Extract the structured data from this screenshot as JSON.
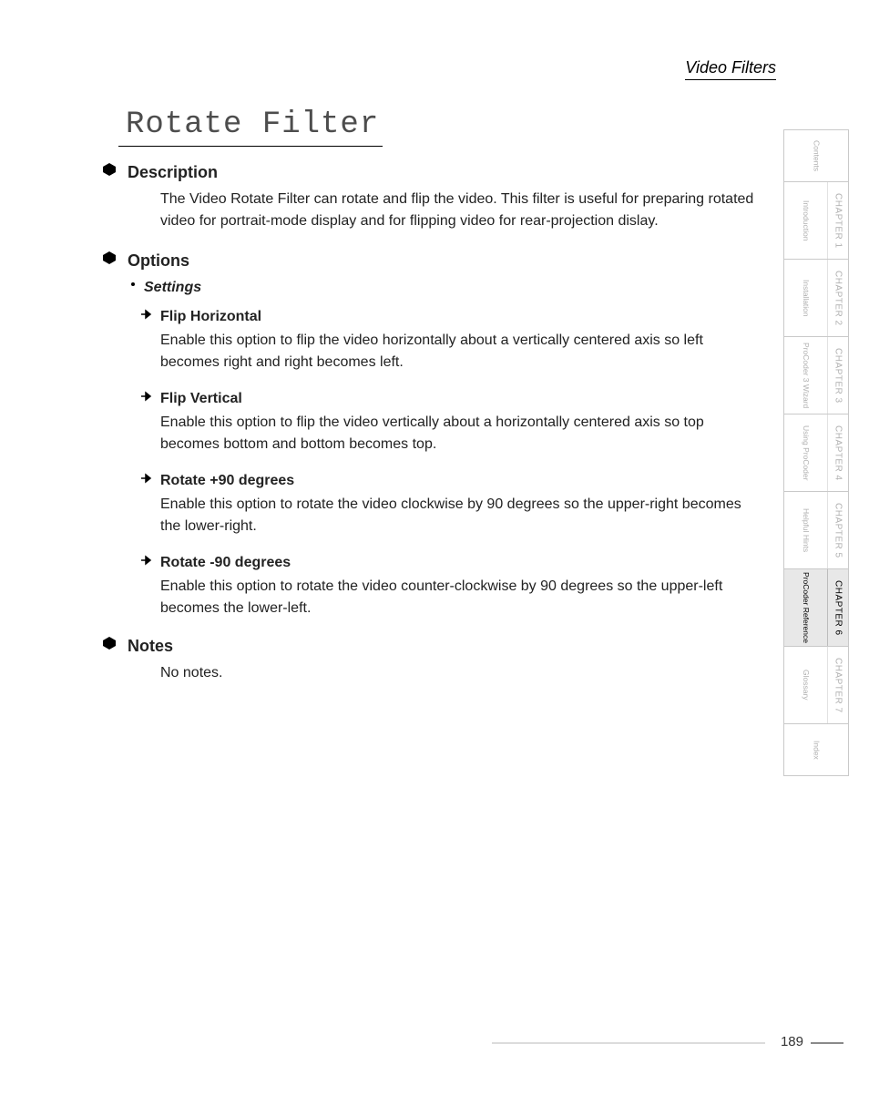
{
  "breadcrumb": "Video Filters",
  "title": "Rotate Filter",
  "sections": {
    "description": {
      "heading": "Description",
      "body": "The Video Rotate Filter can rotate and flip the video. This filter is useful for preparing rotated video for portrait-mode display and for flipping video for rear-projection dislay."
    },
    "options": {
      "heading": "Options",
      "settings_label": "Settings",
      "items": [
        {
          "title": "Flip Horizontal",
          "body": "Enable this option to flip the video horizontally about a vertically centered axis so left becomes right and right becomes left."
        },
        {
          "title": "Flip Vertical",
          "body": "Enable this option to flip the video vertically about a horizontally centered axis so top becomes bottom and bottom becomes top."
        },
        {
          "title": "Rotate +90 degrees",
          "body": "Enable this option to rotate the video clockwise by 90 degrees so the upper-right becomes the lower-right."
        },
        {
          "title": "Rotate -90 degrees",
          "body": "Enable this option to rotate the video counter-clockwise by 90 degrees so the upper-left becomes the lower-left."
        }
      ]
    },
    "notes": {
      "heading": "Notes",
      "body": "No notes."
    }
  },
  "tabs": [
    {
      "chapter": "",
      "label": "Contents",
      "active": false,
      "kind": "single"
    },
    {
      "chapter": "CHAPTER 1",
      "label": "Introduction",
      "active": false,
      "kind": "chapter"
    },
    {
      "chapter": "CHAPTER 2",
      "label": "Installation",
      "active": false,
      "kind": "chapter"
    },
    {
      "chapter": "CHAPTER 3",
      "label": "ProCoder 3 Wizard",
      "active": false,
      "kind": "chapter"
    },
    {
      "chapter": "CHAPTER 4",
      "label": "Using ProCoder",
      "active": false,
      "kind": "chapter"
    },
    {
      "chapter": "CHAPTER 5",
      "label": "Helpful Hints",
      "active": false,
      "kind": "chapter"
    },
    {
      "chapter": "CHAPTER 6",
      "label": "ProCoder Reference",
      "active": true,
      "kind": "chapter"
    },
    {
      "chapter": "CHAPTER 7",
      "label": "Glossary",
      "active": false,
      "kind": "chapter"
    },
    {
      "chapter": "",
      "label": "Index",
      "active": false,
      "kind": "single"
    }
  ],
  "page_number": "189"
}
